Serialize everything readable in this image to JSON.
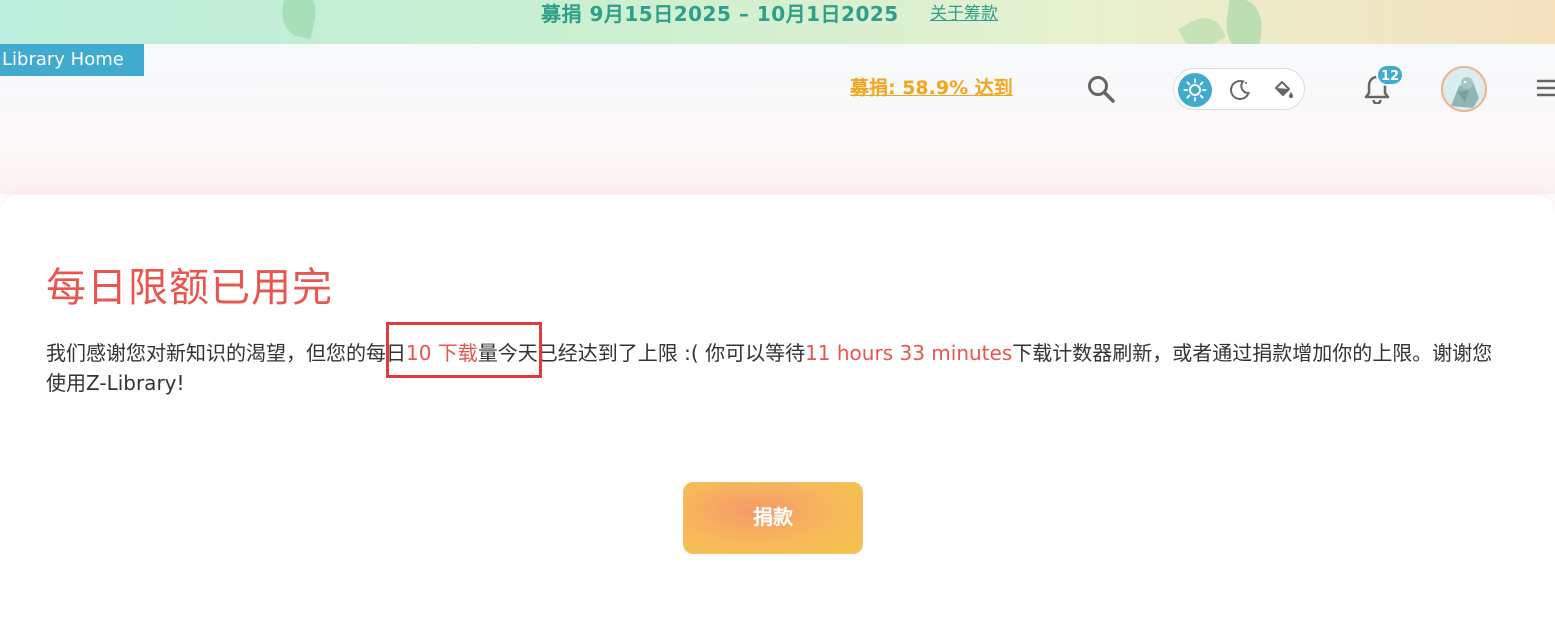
{
  "banner": {
    "text": "募捐 9月15日2025 – 10月1日2025",
    "link": "关于筹款"
  },
  "header": {
    "home_tab": "Library Home",
    "fund_progress": "募捐: 58.9% 达到",
    "notification_count": "12",
    "icons": [
      "search-icon",
      "sun-icon",
      "moon-icon",
      "paint-bucket-icon",
      "bell-icon",
      "avatar",
      "hamburger-menu-icon"
    ]
  },
  "main": {
    "title": "每日限额已用完",
    "message": {
      "part1": "我们感谢您对新知识的渴望，但您的每日",
      "limit": "10 下载",
      "part2": "量今天已经达到了上限 :( 你可以等待",
      "wait": "11 hours 33 minutes",
      "part3": "下载计数器刷新，或者通过捐款增加你的上限。谢谢您使用Z-Library!"
    },
    "donate_button": "捐款"
  },
  "colors": {
    "accent": "#41aacf",
    "warning_red": "#e8564f",
    "fund_orange": "#f2a51e",
    "banner_green": "#2e9f8a"
  }
}
